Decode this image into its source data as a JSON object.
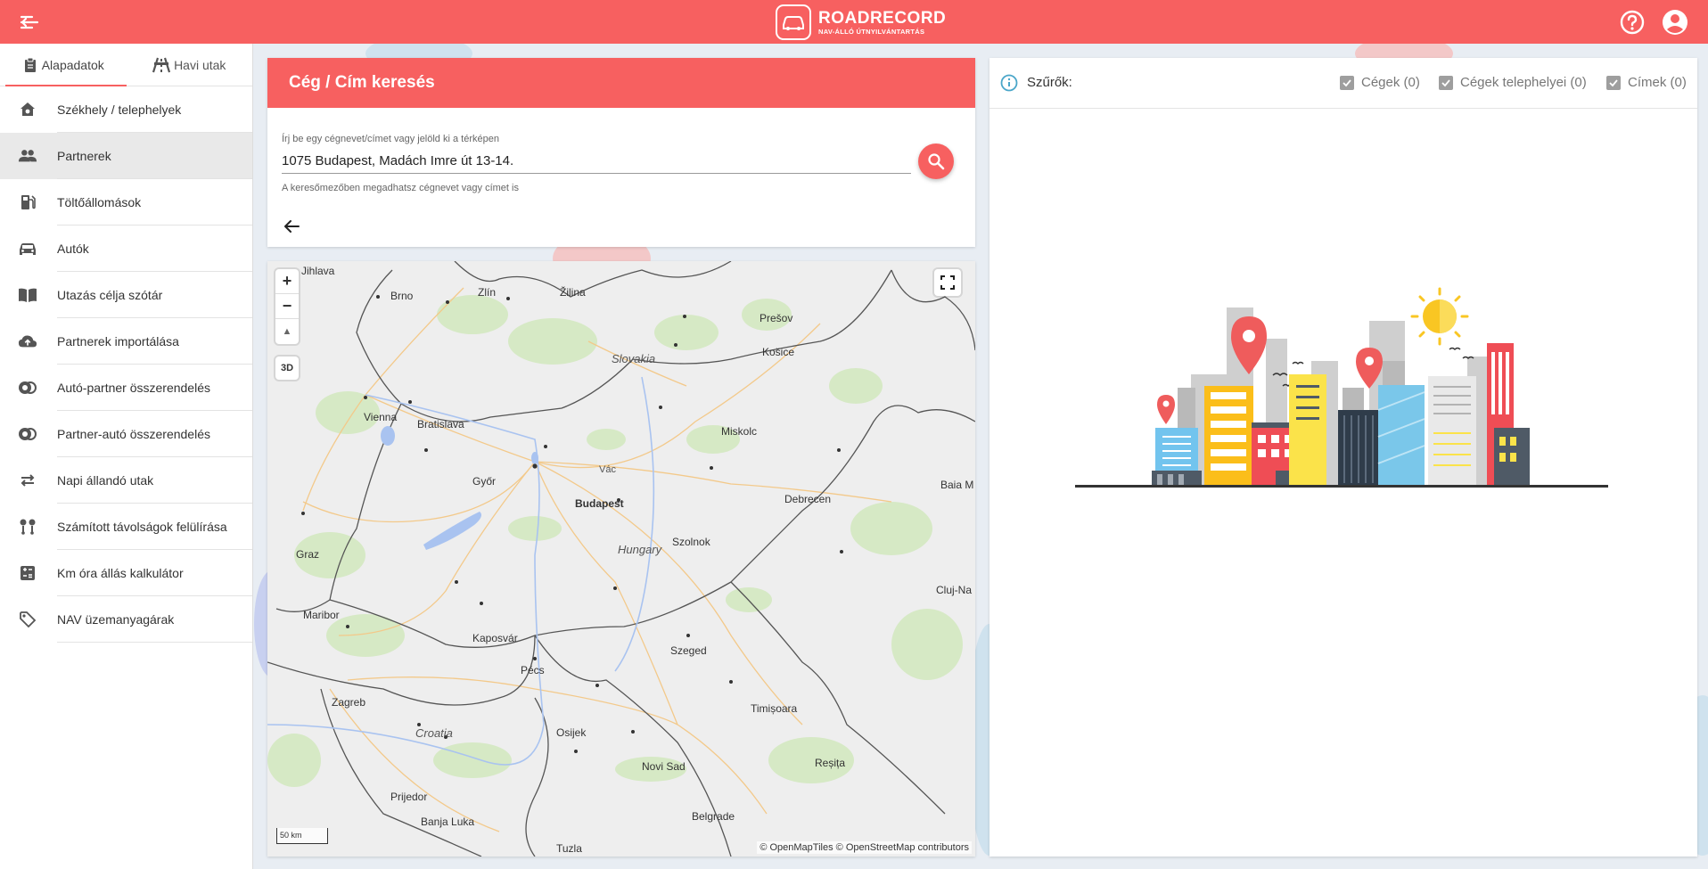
{
  "app": {
    "logo_title": "ROADRECORD",
    "logo_subtitle": "NAV-ÁLLÓ ÚTNYILVÁNTARTÁS",
    "brand_color": "#f76060"
  },
  "sidebar": {
    "tabs": [
      {
        "label": "Alapadatok",
        "icon": "clipboard-icon",
        "active": true
      },
      {
        "label": "Havi utak",
        "icon": "road-icon",
        "active": false
      }
    ],
    "items": [
      {
        "label": "Székhely / telephelyek",
        "icon": "home-icon"
      },
      {
        "label": "Partnerek",
        "icon": "people-icon",
        "active": true
      },
      {
        "label": "Töltőállomások",
        "icon": "gas-station-icon"
      },
      {
        "label": "Autók",
        "icon": "car-icon"
      },
      {
        "label": "Utazás célja szótár",
        "icon": "book-icon"
      },
      {
        "label": "Partnerek importálása",
        "icon": "cloud-upload-icon"
      },
      {
        "label": "Autó-partner összerendelés",
        "icon": "link-icon"
      },
      {
        "label": "Partner-autó összerendelés",
        "icon": "link-icon"
      },
      {
        "label": "Napi állandó utak",
        "icon": "repeat-icon"
      },
      {
        "label": "Számított távolságok felülírása",
        "icon": "route-icon"
      },
      {
        "label": "Km óra állás kalkulátor",
        "icon": "calculator-icon"
      },
      {
        "label": "NAV üzemanyagárak",
        "icon": "tag-icon"
      }
    ]
  },
  "search": {
    "title": "Cég / Cím keresés",
    "label": "Írj be egy cégnevet/címet vagy jelöld ki a térképen",
    "value": "1075 Budapest, Madách Imre út 13-14.",
    "hint": "A keresőmezőben megadhatsz cégnevet vagy címet is"
  },
  "map": {
    "zoom_in": "+",
    "zoom_out": "−",
    "compass": "▲",
    "btn_3d": "3D",
    "scale": "50 km",
    "attribution": "© OpenMapTiles © OpenStreetMap contributors",
    "countries": [
      "Slovakia",
      "Hungary",
      "Croatia"
    ],
    "cities": [
      "Jihlava",
      "Brno",
      "Zlín",
      "Žilina",
      "Prešov",
      "Košice",
      "Vienna",
      "Bratislava",
      "Miskolc",
      "Győr",
      "Vác",
      "Budapest",
      "Debrecen",
      "Baia M",
      "Szolnok",
      "Graz",
      "Cluj-Na",
      "Maribor",
      "Kaposvár",
      "Szeged",
      "Pécs",
      "Zagreb",
      "Timișoara",
      "Osijek",
      "Novi Sad",
      "Reșița",
      "Prijedor",
      "Banja Luka",
      "Belgrade",
      "Tuzla"
    ]
  },
  "filters": {
    "title": "Szűrők:",
    "options": [
      {
        "label": "Cégek (0)",
        "checked": true
      },
      {
        "label": "Cégek telephelyei (0)",
        "checked": true
      },
      {
        "label": "Címek (0)",
        "checked": true
      }
    ]
  }
}
